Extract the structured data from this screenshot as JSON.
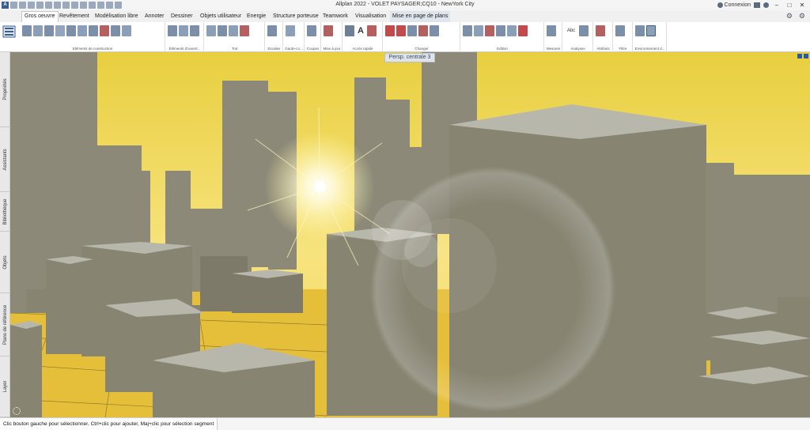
{
  "app": {
    "title": "Allplan 2022 - VOLET PAYSAGER;CQ10 - NewYork City",
    "logo_letter": "A",
    "connexion": "Connexion",
    "window_buttons": [
      "–",
      "□",
      "✕"
    ]
  },
  "menu": {
    "tabs": [
      "Gros oeuvre",
      "Revêtement",
      "Modélisation libre",
      "Annoter",
      "Dessiner",
      "Objets utilisateur",
      "Energie",
      "Structure porteuse",
      "Teamwork",
      "Visualisation",
      "Mise en page de plans"
    ],
    "active_tab": "Gros oeuvre"
  },
  "ribbon": {
    "groups": [
      "Eléments de construction",
      "Eléments d'ouvert...",
      "Toit",
      "Escalier",
      "Garde-co...",
      "Coupes",
      "Mise à jour",
      "Accès rapide",
      "Changer",
      "Edition",
      "Mesures",
      "Analyses",
      "Attributs",
      "Filtre",
      "Environnement d..."
    ],
    "text_icon_label": "A",
    "abc_label": "Abc"
  },
  "side_tabs": [
    "Propriétés",
    "Assistants",
    "Bibliothèque",
    "Objets",
    "Plans de référence",
    "Layer"
  ],
  "viewport": {
    "label": "Persp. centrale 3"
  },
  "status": {
    "text": "Clic bouton gauche pour sélectionner, Ctrl+clic pour ajouter, Maj+clic pour sélection segment"
  },
  "colors": {
    "sky_top": "#e8d24a",
    "sky_horizon": "#f7e27a",
    "building": "#8d8a78",
    "building_top": "#b9b8ae",
    "ground": "#e9c23d",
    "accent": "#2a5aa0"
  }
}
